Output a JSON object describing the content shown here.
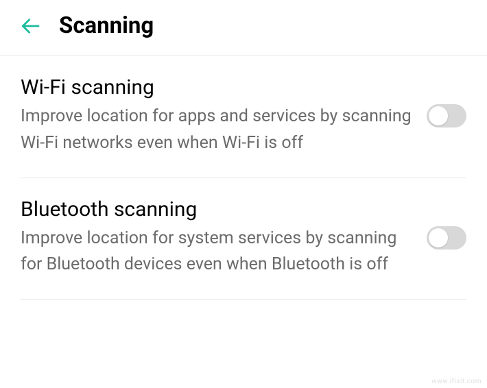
{
  "header": {
    "title": "Scanning"
  },
  "settings": [
    {
      "title": "Wi-Fi scanning",
      "description": "Improve location for apps and services by scanning Wi-Fi networks even when Wi-Fi is off",
      "enabled": false
    },
    {
      "title": "Bluetooth scanning",
      "description": "Improve location for system services by scanning for Bluetooth devices even when Bluetooth is off",
      "enabled": false
    }
  ],
  "watermark": "www.ifixit.com"
}
